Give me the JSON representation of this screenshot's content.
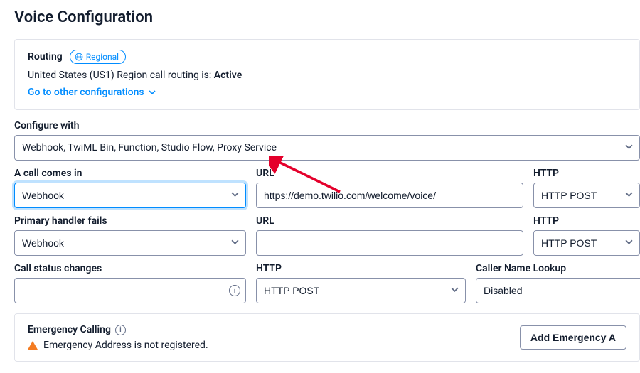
{
  "title": "Voice Configuration",
  "routing": {
    "heading": "Routing",
    "badge": "Regional",
    "status_prefix": "United States (US1) Region call routing is: ",
    "status_value": "Active",
    "link": "Go to other configurations"
  },
  "configure_with": {
    "label": "Configure with",
    "value": "Webhook, TwiML Bin, Function, Studio Flow, Proxy Service"
  },
  "call_comes_in": {
    "label": "A call comes in",
    "handler": "Webhook",
    "url_label": "URL",
    "url_value": "https://demo.twilio.com/welcome/voice/",
    "http_label": "HTTP",
    "http_value": "HTTP POST"
  },
  "primary_handler_fails": {
    "label": "Primary handler fails",
    "handler": "Webhook",
    "url_label": "URL",
    "url_value": "",
    "http_label": "HTTP",
    "http_value": "HTTP POST"
  },
  "call_status_changes": {
    "label": "Call status changes",
    "value": "",
    "http_label": "HTTP",
    "http_value": "HTTP POST",
    "caller_lookup_label": "Caller Name Lookup",
    "caller_lookup_value": "Disabled"
  },
  "emergency": {
    "title": "Emergency Calling",
    "subtitle": "Emergency Address is not registered.",
    "button": "Add Emergency A"
  }
}
